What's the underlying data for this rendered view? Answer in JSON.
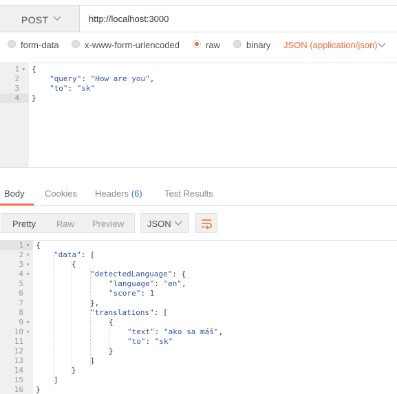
{
  "request": {
    "method": "POST",
    "url": "http://localhost:3000"
  },
  "body_types": {
    "options": [
      "form-data",
      "x-www-form-urlencoded",
      "raw",
      "binary"
    ],
    "selected": "raw",
    "content_type": "JSON (application/json)"
  },
  "request_body": {
    "line_numbers": [
      "1",
      "2",
      "3",
      "4"
    ],
    "open_brace": "{",
    "query_key": "\"query\"",
    "query_value": "\"How are you\"",
    "to_key": "\"to\"",
    "to_value": "\"sk\"",
    "close_brace": "}"
  },
  "response_tabs": {
    "body": "Body",
    "cookies": "Cookies",
    "headers": "Headers",
    "headers_count": "(6)",
    "test_results": "Test Results"
  },
  "view_modes": {
    "pretty": "Pretty",
    "raw": "Raw",
    "preview": "Preview",
    "format": "JSON"
  },
  "response_body": {
    "line_numbers": [
      "1",
      "2",
      "3",
      "4",
      "5",
      "6",
      "7",
      "8",
      "9",
      "10",
      "11",
      "12",
      "13",
      "14",
      "15",
      "16"
    ],
    "data_key": "\"data\"",
    "detected_key": "\"detectedLanguage\"",
    "language_key": "\"language\"",
    "language_value": "\"en\"",
    "score_key": "\"score\"",
    "score_value": "1",
    "translations_key": "\"translations\"",
    "text_key": "\"text\"",
    "text_value": "\"ako sa máš\"",
    "to_key": "\"to\"",
    "to_value": "\"sk\""
  },
  "colors": {
    "accent": "#f26b3a",
    "code_string": "#2e52a8",
    "count_blue": "#2e72c9"
  }
}
